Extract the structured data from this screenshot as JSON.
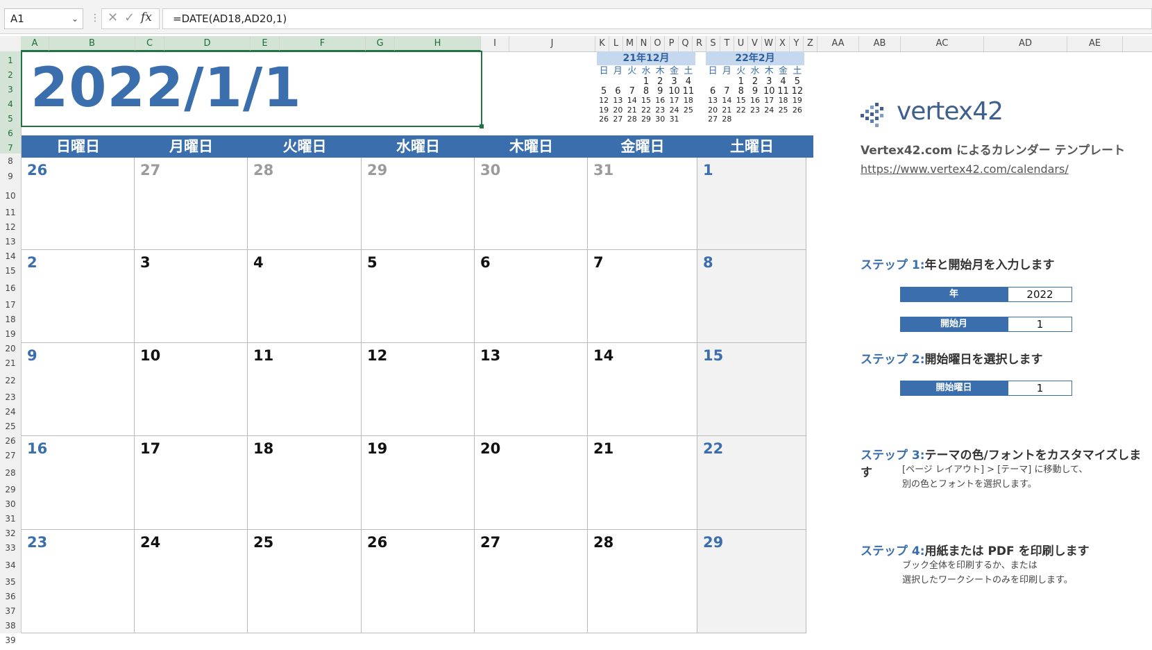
{
  "formula_bar": {
    "name_box": "A1",
    "separator": "⋮",
    "cancel_icon": "✕",
    "enter_icon": "✓",
    "fx_label": "fx",
    "formula": "=DATE(AD18,AD20,1)"
  },
  "columns": [
    "A",
    "B",
    "C",
    "D",
    "E",
    "F",
    "G",
    "H",
    "I",
    "J",
    "K",
    "L",
    "M",
    "N",
    "O",
    "P",
    "Q",
    "R",
    "S",
    "T",
    "U",
    "V",
    "W",
    "X",
    "Y",
    "Z",
    "AA",
    "AB",
    "AC",
    "AD",
    "AE"
  ],
  "rows": [
    "1",
    "2",
    "3",
    "4",
    "5",
    "6",
    "7",
    "8",
    "9",
    "10",
    "11",
    "12",
    "13",
    "14",
    "15",
    "16",
    "17",
    "18",
    "19",
    "20",
    "21",
    "22",
    "23",
    "24",
    "25",
    "26",
    "27",
    "28",
    "29",
    "30",
    "31",
    "32",
    "33",
    "34",
    "35",
    "36",
    "37",
    "38",
    "39"
  ],
  "main_date": "2022/1/1",
  "mini_calendars": [
    {
      "title": "21年12月",
      "dow": [
        "日",
        "月",
        "火",
        "水",
        "木",
        "金",
        "土"
      ],
      "weeks": [
        [
          "",
          "",
          "",
          "1",
          "2",
          "3",
          "4"
        ],
        [
          "5",
          "6",
          "7",
          "8",
          "9",
          "10",
          "11"
        ],
        [
          "12",
          "13",
          "14",
          "15",
          "16",
          "17",
          "18"
        ],
        [
          "19",
          "20",
          "21",
          "22",
          "23",
          "24",
          "25"
        ],
        [
          "26",
          "27",
          "28",
          "29",
          "30",
          "31",
          ""
        ]
      ]
    },
    {
      "title": "22年2月",
      "dow": [
        "日",
        "月",
        "火",
        "水",
        "木",
        "金",
        "土"
      ],
      "weeks": [
        [
          "",
          "",
          "1",
          "2",
          "3",
          "4",
          "5"
        ],
        [
          "6",
          "7",
          "8",
          "9",
          "10",
          "11",
          "12"
        ],
        [
          "13",
          "14",
          "15",
          "16",
          "17",
          "18",
          "19"
        ],
        [
          "20",
          "21",
          "22",
          "23",
          "24",
          "25",
          "26"
        ],
        [
          "27",
          "28",
          "",
          "",
          "",
          "",
          ""
        ]
      ]
    }
  ],
  "weekdays": [
    "日曜日",
    "月曜日",
    "火曜日",
    "水曜日",
    "木曜日",
    "金曜日",
    "土曜日"
  ],
  "weeks": [
    [
      {
        "d": "26",
        "other": true
      },
      {
        "d": "27",
        "other": true
      },
      {
        "d": "28",
        "other": true
      },
      {
        "d": "29",
        "other": true
      },
      {
        "d": "30",
        "other": true
      },
      {
        "d": "31",
        "other": true
      },
      {
        "d": "1",
        "other": false
      }
    ],
    [
      {
        "d": "2",
        "other": false
      },
      {
        "d": "3",
        "other": false
      },
      {
        "d": "4",
        "other": false
      },
      {
        "d": "5",
        "other": false
      },
      {
        "d": "6",
        "other": false
      },
      {
        "d": "7",
        "other": false
      },
      {
        "d": "8",
        "other": false
      }
    ],
    [
      {
        "d": "9",
        "other": false
      },
      {
        "d": "10",
        "other": false
      },
      {
        "d": "11",
        "other": false
      },
      {
        "d": "12",
        "other": false
      },
      {
        "d": "13",
        "other": false
      },
      {
        "d": "14",
        "other": false
      },
      {
        "d": "15",
        "other": false
      }
    ],
    [
      {
        "d": "16",
        "other": false
      },
      {
        "d": "17",
        "other": false
      },
      {
        "d": "18",
        "other": false
      },
      {
        "d": "19",
        "other": false
      },
      {
        "d": "20",
        "other": false
      },
      {
        "d": "21",
        "other": false
      },
      {
        "d": "22",
        "other": false
      }
    ],
    [
      {
        "d": "23",
        "other": false
      },
      {
        "d": "24",
        "other": false
      },
      {
        "d": "25",
        "other": false
      },
      {
        "d": "26",
        "other": false
      },
      {
        "d": "27",
        "other": false
      },
      {
        "d": "28",
        "other": false
      },
      {
        "d": "29",
        "other": false
      }
    ]
  ],
  "panel": {
    "logo": "vertex42",
    "template_title": "Vertex42.com によるカレンダー テンプレート",
    "template_link": "https://www.vertex42.com/calendars/",
    "steps": [
      {
        "name": "ステップ 1:",
        "text": "年と開始月を入力します"
      },
      {
        "name": "ステップ 2:",
        "text": "開始曜日を選択します"
      },
      {
        "name": "ステップ 3:",
        "text": "テーマの色/フォントをカスタマイズします"
      },
      {
        "name": "ステップ 4:",
        "text": "用紙または PDF を印刷します"
      }
    ],
    "inputs": [
      {
        "label": "年",
        "value": "2022"
      },
      {
        "label": "開始月",
        "value": "1"
      },
      {
        "label": "開始曜日",
        "value": "1"
      }
    ],
    "step3_desc": [
      "[ページ レイアウト] > [テーマ] に移動して、",
      "別の色とフォントを選択します。"
    ],
    "step4_desc": [
      "ブック全体を印刷するか、または",
      "選択したワークシートのみを印刷します。"
    ]
  },
  "colors": {
    "accent": "#3a6eac",
    "selection": "#217346",
    "weekend_bg": "#f2f2f2"
  }
}
